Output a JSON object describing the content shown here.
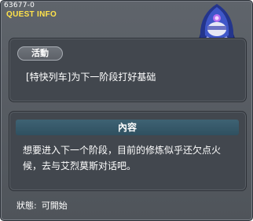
{
  "header": {
    "quest_id": "63677-0",
    "title": "QUEST INFO"
  },
  "quest": {
    "category_badge": "活動",
    "name": "[特快列车]为下一阶段打好基础"
  },
  "content": {
    "header": "內容",
    "body": "想要进入下一个阶段，目前的修炼似乎还欠点火候，去与艾烈莫斯对话吧。"
  },
  "status": {
    "label": "狀態:",
    "value": "可開始"
  },
  "npc": {
    "icon": "hooded-npc-portrait"
  }
}
